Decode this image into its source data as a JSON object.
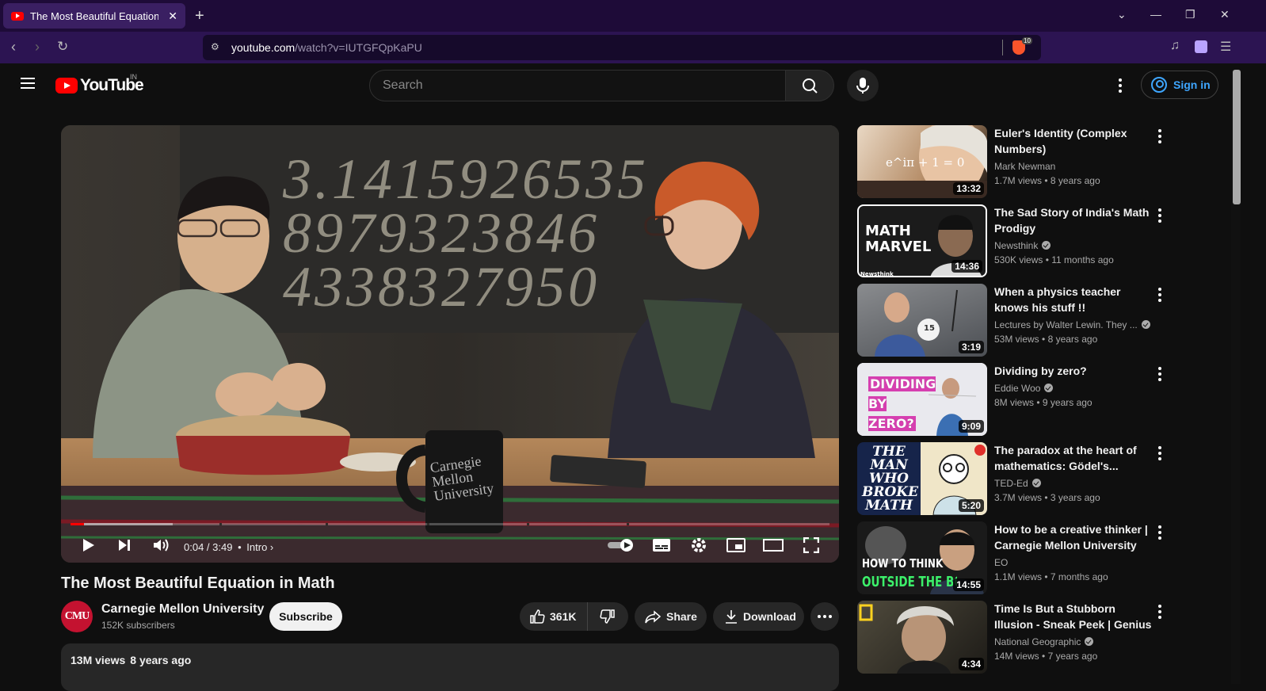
{
  "browser": {
    "tab_title": "The Most Beautiful Equation in",
    "new_tab": "+",
    "url_host": "youtube.com",
    "url_path": "/watch?v=IUTGFQpKaPU",
    "shields_count": "10"
  },
  "header": {
    "logo_text": "YouTube",
    "country_code": "IN",
    "search_placeholder": "Search",
    "sign_in_label": "Sign in"
  },
  "player": {
    "board_text": "3.1415926535\n8979323846\n4338327950",
    "mug_text": "Carnegie\nMellon\nUniversity",
    "time_current": "0:04",
    "time_total": "3:49",
    "time_separator": " / ",
    "chapter": "Intro",
    "played_fraction": 0.018,
    "buffered_fraction": 0.135
  },
  "video": {
    "title": "The Most Beautiful Equation in Math",
    "channel_name": "Carnegie Mellon University",
    "channel_avatar_text": "CMU",
    "subscribers": "152K subscribers",
    "subscribe_label": "Subscribe",
    "likes": "361K",
    "share_label": "Share",
    "download_label": "Download",
    "views": "13M views",
    "age": "8 years ago"
  },
  "recommendations": [
    {
      "title": "Euler's Identity (Complex Numbers)",
      "channel": "Mark Newman",
      "verified": false,
      "views": "1.7M views",
      "age": "8 years ago",
      "duration": "13:32",
      "thumb_text": "e^iπ + 1 = 0"
    },
    {
      "title": "The Sad Story of India's Math Prodigy",
      "channel": "Newsthink",
      "verified": true,
      "views": "530K views",
      "age": "11 months ago",
      "duration": "14:36",
      "thumb_text": "MATH\nMARVEL",
      "thumb_small": "Newsthink"
    },
    {
      "title": "When a physics teacher knows his stuff !!",
      "channel": "Lectures by Walter Lewin. They ...",
      "verified": true,
      "views": "53M views",
      "age": "8 years ago",
      "duration": "3:19",
      "thumb_text": "15"
    },
    {
      "title": "Dividing by zero?",
      "channel": "Eddie Woo",
      "verified": true,
      "views": "8M views",
      "age": "9 years ago",
      "duration": "9:09",
      "thumb_text": "DIVIDING\nBY\nZERO?"
    },
    {
      "title": "The paradox at the heart of mathematics: Gödel's...",
      "channel": "TED-Ed",
      "verified": true,
      "views": "3.7M views",
      "age": "3 years ago",
      "duration": "5:20",
      "thumb_text": "THE\nMAN\nWHO\nBROKE\nMATH"
    },
    {
      "title": "How to be a creative thinker | Carnegie Mellon University Po...",
      "channel": "EO",
      "verified": false,
      "views": "1.1M views",
      "age": "7 months ago",
      "duration": "14:55",
      "thumb_text": "HOW TO THINK",
      "thumb_text2": "OUTSIDE THE BOX"
    },
    {
      "title": "Time Is But a Stubborn Illusion - Sneak Peek | Genius",
      "channel": "National Geographic",
      "verified": true,
      "views": "14M views",
      "age": "7 years ago",
      "duration": "4:34",
      "thumb_text": ""
    }
  ],
  "colors": {
    "brand_red": "#ff0000",
    "link_blue": "#3ea6ff",
    "browser_bg": "#1e0b38"
  },
  "icons": [
    "back-icon",
    "forward-icon",
    "reload-icon",
    "tune-icon",
    "brave-shield-icon",
    "playlist-icon",
    "wallet-icon",
    "menu-icon",
    "search-icon",
    "mic-icon",
    "more-vert-icon",
    "account-icon",
    "play-icon",
    "next-icon",
    "volume-icon",
    "autoplay-toggle",
    "subtitles-icon",
    "settings-icon",
    "miniplayer-icon",
    "theater-icon",
    "fullscreen-icon",
    "like-icon",
    "dislike-icon",
    "share-icon",
    "download-icon"
  ]
}
